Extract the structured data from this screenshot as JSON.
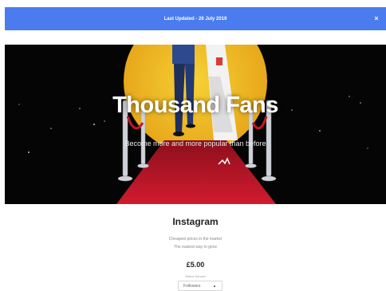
{
  "announcement": {
    "text": "Last Updated - 26 July 2019",
    "close_label": "×"
  },
  "hero": {
    "title": "Thousand Fans",
    "subtitle": "Become more and more popular than before"
  },
  "product": {
    "title": "Instagram",
    "tagline_1": "Cheapest prices in the market",
    "tagline_2": "The easiest way to grow",
    "price": "£5.00",
    "select_label": "Select Service",
    "select_value": "Followers",
    "caret": "▲"
  },
  "colors": {
    "announcement_bg": "#4a7cf0",
    "hero_bg": "#050505",
    "spotlight": "#f2c21b",
    "carpet": "#c3172a"
  }
}
